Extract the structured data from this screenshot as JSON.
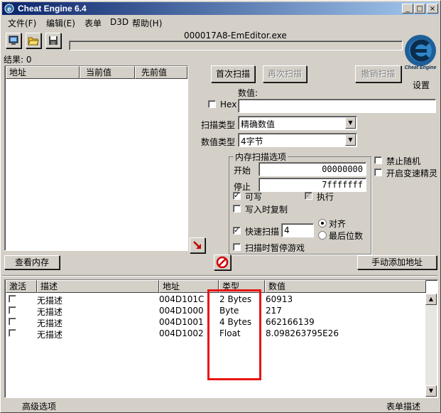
{
  "window": {
    "title": "Cheat Engine 6.4",
    "minimize": "_",
    "maximize": "□",
    "close": "×"
  },
  "menu": [
    {
      "label": "文件(F)"
    },
    {
      "label": "编辑(E)"
    },
    {
      "label": "表单"
    },
    {
      "label": "D3D"
    },
    {
      "label": "帮助(H)"
    }
  ],
  "process": {
    "name": "000017A8-EmEditor.exe"
  },
  "results": {
    "label": "结果: 0"
  },
  "found_list": {
    "headers": [
      "地址",
      "当前值",
      "先前值"
    ]
  },
  "scan": {
    "first_scan": "首次扫描",
    "next_scan": "再次扫描",
    "undo_scan": "撤销扫描",
    "settings": "设置",
    "value_label": "数值:",
    "value": "",
    "hex_label": "Hex",
    "scan_type_label": "扫描类型",
    "scan_type_value": "精确数值",
    "value_type_label": "数值类型",
    "value_type_value": "4字节"
  },
  "memory_options": {
    "title": "内存扫描选项",
    "start_label": "开始",
    "start_value": "00000000",
    "stop_label": "停止",
    "stop_value": "7fffffff",
    "writable": "可写",
    "executable": "执行",
    "copy_on_write": "写入时复制",
    "fast_scan": "快速扫描",
    "fast_scan_value": "4",
    "align": "对齐",
    "last_digits": "最后位数",
    "pause_game": "扫描时暂停游戏"
  },
  "side_options": {
    "no_random": "禁止随机",
    "speedhack": "开启变速精灵"
  },
  "buttons": {
    "memory_view": "查看内存",
    "add_address": "手动添加地址"
  },
  "address_table": {
    "headers": [
      "激活",
      "描述",
      "地址",
      "类型",
      "数值"
    ],
    "rows": [
      {
        "desc": "无描述",
        "addr": "004D101C",
        "type": "2 Bytes",
        "value": "60913"
      },
      {
        "desc": "无描述",
        "addr": "004D1000",
        "type": "Byte",
        "value": "217"
      },
      {
        "desc": "无描述",
        "addr": "004D1001",
        "type": "4 Bytes",
        "value": "662166139"
      },
      {
        "desc": "无描述",
        "addr": "004D1002",
        "type": "Float",
        "value": "8.098263795E26"
      }
    ]
  },
  "footer": {
    "advanced": "高级选项",
    "table_extras": "表单描述"
  },
  "colors": {
    "title_start": "#0a246a",
    "title_end": "#a6caf0",
    "highlight_box": "#e81414",
    "face": "#d4d0c8"
  },
  "logo": {
    "text": "Cheat Engine"
  }
}
